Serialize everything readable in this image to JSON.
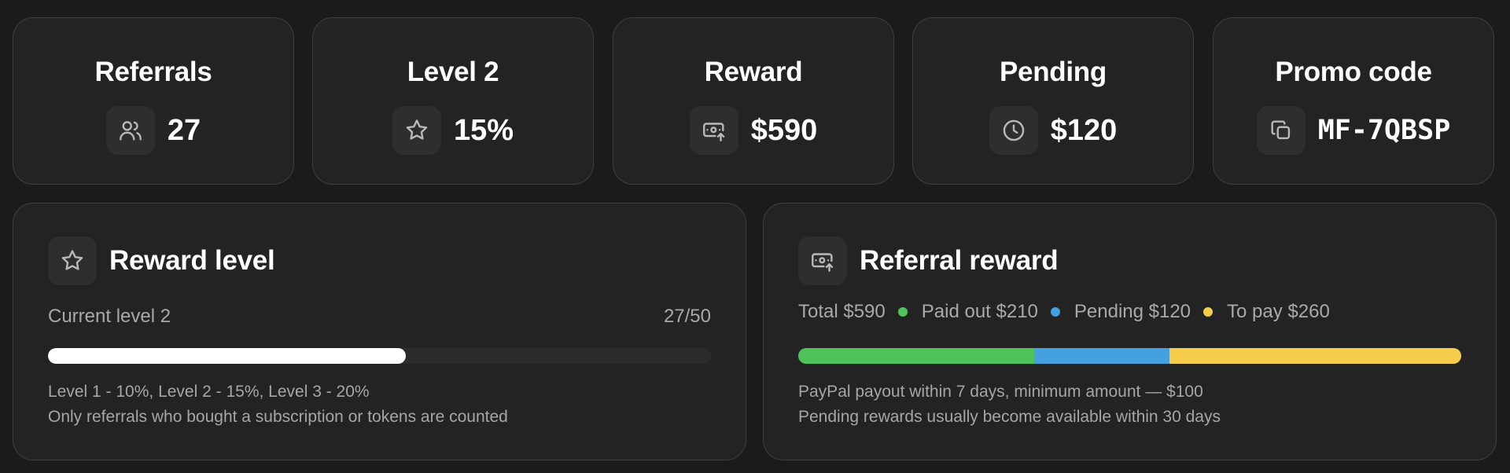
{
  "stats": [
    {
      "title": "Referrals",
      "value": "27",
      "icon": "users-icon"
    },
    {
      "title": "Level 2",
      "value": "15%",
      "icon": "star-icon"
    },
    {
      "title": "Reward",
      "value": "$590",
      "icon": "cash-upload-icon"
    },
    {
      "title": "Pending",
      "value": "$120",
      "icon": "clock-icon"
    },
    {
      "title": "Promo code",
      "value": "MF-7QBSP",
      "icon": "copy-icon"
    }
  ],
  "reward_level": {
    "title": "Reward level",
    "icon": "star-icon",
    "current_label": "Current level 2",
    "progress_text": "27/50",
    "progress_fraction": 0.54,
    "note_line1": "Level 1 - 10%, Level 2 - 15%, Level 3 - 20%",
    "note_line2": "Only referrals who bought a subscription or tokens are counted"
  },
  "referral_reward": {
    "title": "Referral reward",
    "icon": "cash-upload-icon",
    "total_label": "Total $590",
    "segments": [
      {
        "label": "Paid out $210",
        "value": 210,
        "color": "#4fc35a"
      },
      {
        "label": "Pending $120",
        "value": 120,
        "color": "#44a0de"
      },
      {
        "label": "To pay $260",
        "value": 260,
        "color": "#f5cd4a"
      }
    ],
    "note_line1": "PayPal payout within 7 days, minimum amount — $100",
    "note_line2": "Pending rewards usually become available within 30 days"
  },
  "colors": {
    "background": "#1b1b1b",
    "card": "#232323",
    "progress_fill": "#ffffff"
  }
}
